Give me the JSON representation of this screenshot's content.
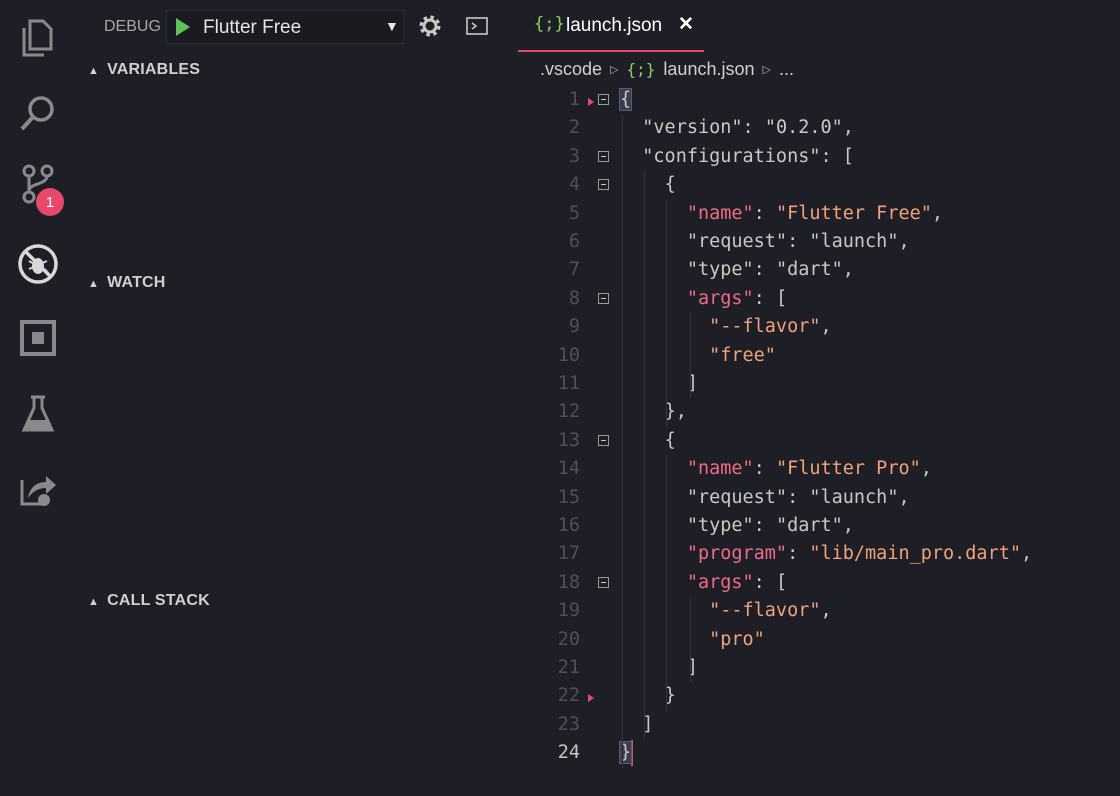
{
  "activity_bar": {
    "items": [
      {
        "icon": "files-icon"
      },
      {
        "icon": "search-icon"
      },
      {
        "icon": "source-control-icon",
        "badge": "1"
      },
      {
        "icon": "debug-icon"
      },
      {
        "icon": "extensions-icon"
      },
      {
        "icon": "test-flask-icon"
      },
      {
        "icon": "live-share-icon"
      }
    ]
  },
  "debug": {
    "label": "DEBUG",
    "configuration": "Flutter Free",
    "caret": "▼"
  },
  "sections": {
    "variables": "VARIABLES",
    "watch": "WATCH",
    "call_stack": "CALL STACK"
  },
  "editor": {
    "tab": {
      "icon": "{;}",
      "label": "launch.json",
      "close": "✕"
    },
    "breadcrumb": {
      "folder": ".vscode",
      "icon": "{;}",
      "file": "launch.json",
      "more": "..."
    },
    "current_line": 24,
    "lines": [
      {
        "n": "1",
        "text": "{"
      },
      {
        "n": "2",
        "text": "  \"version\": \"0.2.0\","
      },
      {
        "n": "3",
        "text": "  \"configurations\": ["
      },
      {
        "n": "4",
        "text": "    {"
      },
      {
        "n": "5",
        "text": "      \"name\": \"Flutter Free\","
      },
      {
        "n": "6",
        "text": "      \"request\": \"launch\","
      },
      {
        "n": "7",
        "text": "      \"type\": \"dart\","
      },
      {
        "n": "8",
        "text": "      \"args\": ["
      },
      {
        "n": "9",
        "text": "        \"--flavor\","
      },
      {
        "n": "10",
        "text": "        \"free\""
      },
      {
        "n": "11",
        "text": "      ]"
      },
      {
        "n": "12",
        "text": "    },"
      },
      {
        "n": "13",
        "text": "    {"
      },
      {
        "n": "14",
        "text": "      \"name\": \"Flutter Pro\","
      },
      {
        "n": "15",
        "text": "      \"request\": \"launch\","
      },
      {
        "n": "16",
        "text": "      \"type\": \"dart\","
      },
      {
        "n": "17",
        "text": "      \"program\": \"lib/main_pro.dart\","
      },
      {
        "n": "18",
        "text": "      \"args\": ["
      },
      {
        "n": "19",
        "text": "        \"--flavor\","
      },
      {
        "n": "20",
        "text": "        \"pro\""
      },
      {
        "n": "21",
        "text": "      ]"
      },
      {
        "n": "22",
        "text": "    }"
      },
      {
        "n": "23",
        "text": "  ]"
      },
      {
        "n": "24",
        "text": "}"
      }
    ]
  },
  "colors": {
    "accent": "#e8486a",
    "string": "#f0a27a",
    "highlight_key": "#f06b86",
    "json_icon": "#8fcf5c",
    "play": "#5fc25a"
  }
}
